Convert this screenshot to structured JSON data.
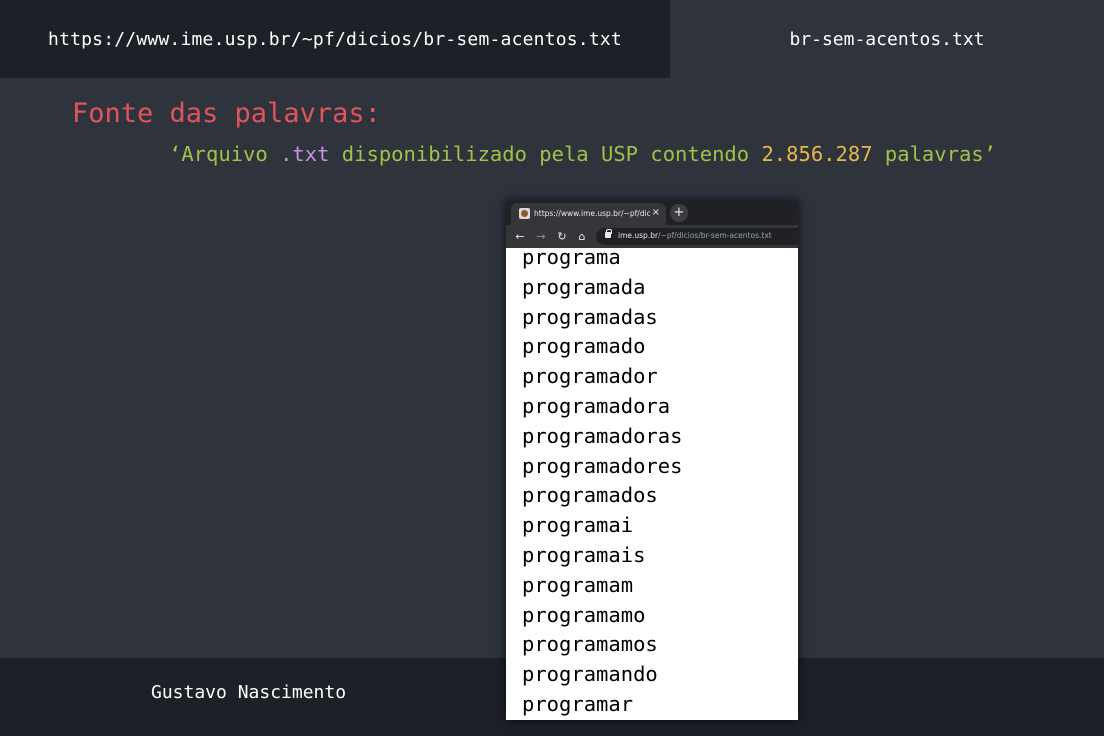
{
  "header": {
    "active_tab": "https://www.ime.usp.br/~pf/dicios/br-sem-acentos.txt",
    "other_tab": "br-sem-acentos.txt"
  },
  "main": {
    "heading": "Fonte das palavras:",
    "subline": {
      "open_quote": "‘",
      "part1": "Arquivo ",
      "ext": ".txt",
      "part2": " disponibilizado pela USP contendo ",
      "count": "2.856.287",
      "part3": " palavras",
      "close_quote": "’"
    }
  },
  "footer": {
    "author": "Gustavo Nascimento"
  },
  "browser": {
    "tab_title": "https://www.ime.usp.br/~pf/dicios/br-sem-acentos.txt",
    "tab_close": "×",
    "new_tab": "+",
    "back": "←",
    "forward": "→",
    "reload": "↻",
    "home": "⌂",
    "url_host": "ime.usp.br",
    "url_path": "/~pf/dicios/br-sem-acentos.txt",
    "words": [
      "programa",
      "programada",
      "programadas",
      "programado",
      "programador",
      "programadora",
      "programadoras",
      "programadores",
      "programados",
      "programai",
      "programais",
      "programam",
      "programamo",
      "programamos",
      "programando",
      "programar"
    ]
  },
  "colors": {
    "background": "#2f333c",
    "bar": "#1d2027",
    "heading": "#e0545b",
    "string": "#a2c04a",
    "keyword": "#c98fe0",
    "number": "#e5b84b"
  }
}
